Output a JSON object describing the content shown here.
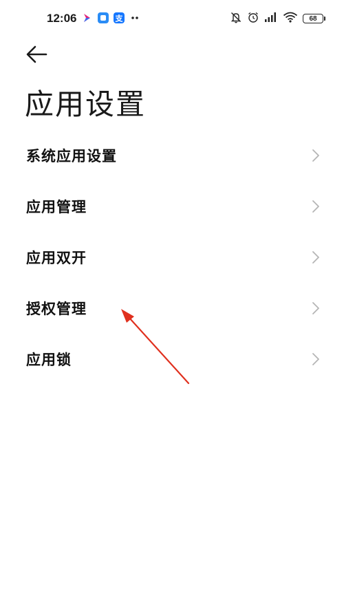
{
  "status_bar": {
    "time": "12:06",
    "battery": "68",
    "notification_icons": [
      "app-arrow-icon",
      "chat-app-icon",
      "alipay-icon",
      "more-dots-icon"
    ],
    "right_icons": [
      "mute-bell-icon",
      "alarm-icon",
      "signal-icon",
      "wifi-icon",
      "battery-icon"
    ]
  },
  "header": {
    "back_icon": "back-arrow-icon",
    "title": "应用设置"
  },
  "menu": {
    "items": [
      {
        "label": "系统应用设置"
      },
      {
        "label": "应用管理"
      },
      {
        "label": "应用双开"
      },
      {
        "label": "授权管理"
      },
      {
        "label": "应用锁"
      }
    ]
  },
  "colors": {
    "background": "#ffffff",
    "text": "#111111",
    "chevron": "#b5b5b5",
    "annotation_arrow": "#e0301e"
  }
}
